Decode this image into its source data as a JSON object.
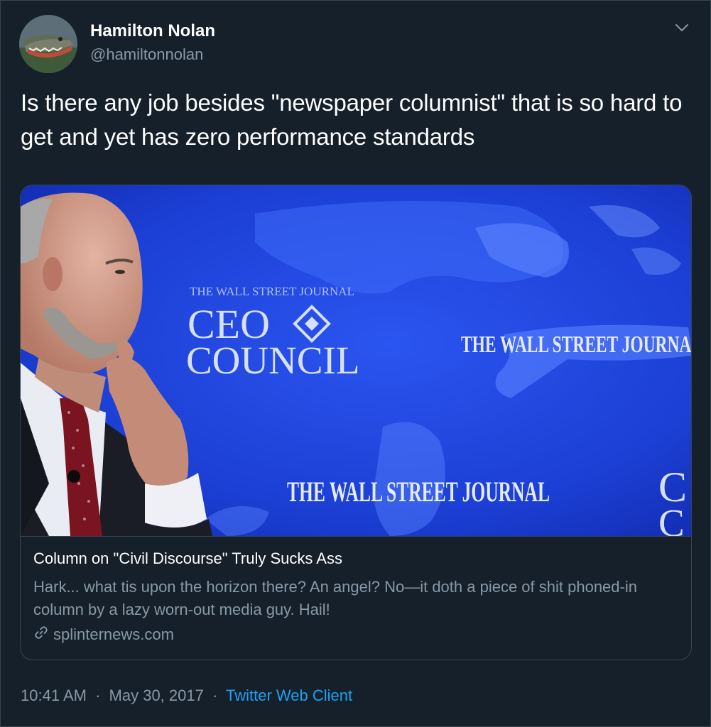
{
  "author": {
    "name": "Hamilton Nolan",
    "handle": "@hamiltonnolan",
    "avatar_icon": "alligator-avatar"
  },
  "menu_icon": "chevron-down-icon",
  "tweet": {
    "text": "Is there any job besides \"newspaper columnist\" that is so hard to get and yet has zero performance standards"
  },
  "card": {
    "image": {
      "signs": {
        "ceo_small": "THE WALL STREET JOURNAL",
        "ceo_line1": "CEO",
        "ceo_line2": "COUNCIL",
        "wsj_right": "THE WALL STREET JOURNAL",
        "wsj_bottom": "THE WALL STREET JOURNAL",
        "edge_c1": "C",
        "edge_c2": "C"
      }
    },
    "title": "Column on \"Civil Discourse\" Truly Sucks Ass",
    "description": "Hark... what tis upon the horizon there? An angel? No—it doth a piece of shit phoned-in column by a lazy worn-out media guy. Hail!",
    "domain": "splinternews.com",
    "domain_icon": "link-icon"
  },
  "meta": {
    "time": "10:41 AM",
    "separator": "·",
    "date": "May 30, 2017",
    "source": "Twitter Web Client"
  },
  "colors": {
    "background": "#15202b",
    "border": "#38444d",
    "text_primary": "#ffffff",
    "text_secondary": "#8899a6",
    "accent": "#1da1f2"
  }
}
